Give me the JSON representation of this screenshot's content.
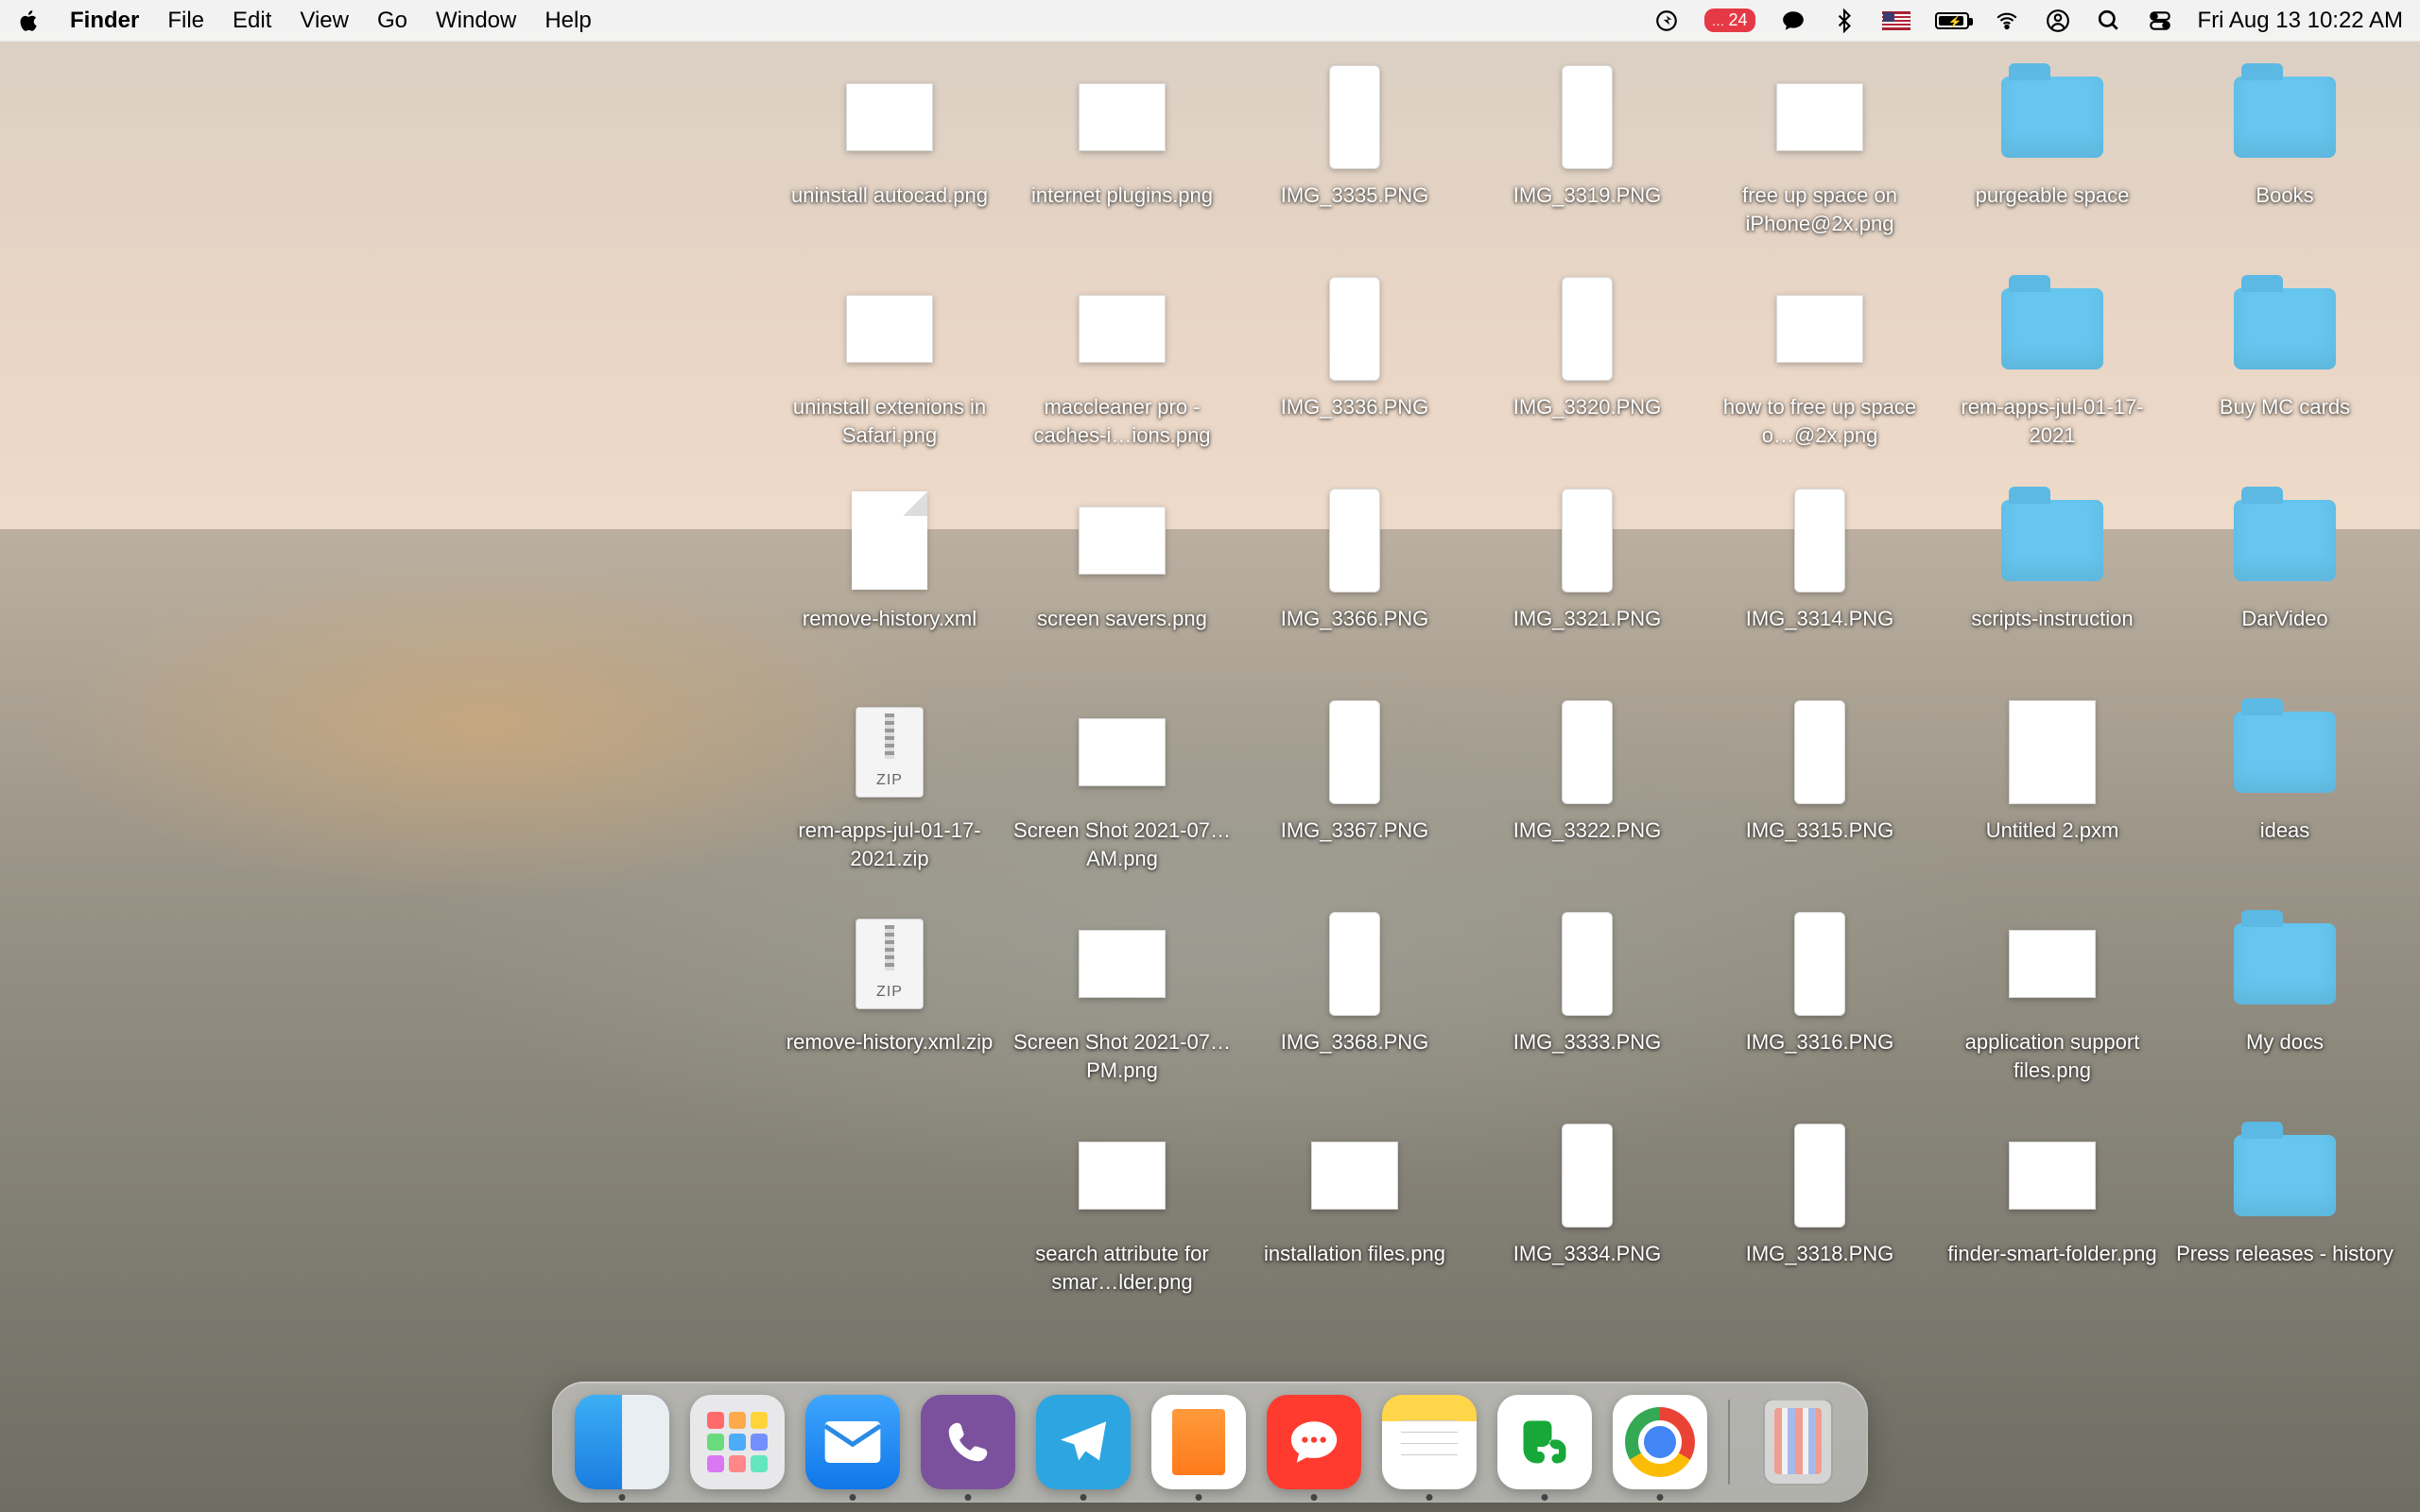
{
  "menubar": {
    "app": "Finder",
    "items": [
      "File",
      "Edit",
      "View",
      "Go",
      "Window",
      "Help"
    ],
    "notification_badge": "24",
    "clock": "Fri Aug 13  10:22 AM"
  },
  "desktop_icons": [
    {
      "row": 0,
      "col": 0,
      "type": "img",
      "label": "uninstall autocad.png"
    },
    {
      "row": 0,
      "col": 1,
      "type": "img",
      "label": "internet plugins.png"
    },
    {
      "row": 0,
      "col": 2,
      "type": "phone",
      "label": "IMG_3335.PNG"
    },
    {
      "row": 0,
      "col": 3,
      "type": "phone",
      "label": "IMG_3319.PNG"
    },
    {
      "row": 0,
      "col": 4,
      "type": "img",
      "label": "free up space on iPhone@2x.png"
    },
    {
      "row": 0,
      "col": 5,
      "type": "folder",
      "label": "purgeable space"
    },
    {
      "row": 0,
      "col": 6,
      "type": "folder",
      "label": "Books"
    },
    {
      "row": 1,
      "col": 0,
      "type": "img",
      "label": "uninstall extenions in Safari.png"
    },
    {
      "row": 1,
      "col": 1,
      "type": "img",
      "label": "maccleaner pro - caches-i…ions.png"
    },
    {
      "row": 1,
      "col": 2,
      "type": "phone",
      "label": "IMG_3336.PNG"
    },
    {
      "row": 1,
      "col": 3,
      "type": "phone",
      "label": "IMG_3320.PNG"
    },
    {
      "row": 1,
      "col": 4,
      "type": "img",
      "label": "how to free up space o…@2x.png"
    },
    {
      "row": 1,
      "col": 5,
      "type": "folder",
      "label": "rem-apps-jul-01-17-2021"
    },
    {
      "row": 1,
      "col": 6,
      "type": "folder",
      "label": "Buy MC cards"
    },
    {
      "row": 2,
      "col": 0,
      "type": "doc",
      "label": "remove-history.xml"
    },
    {
      "row": 2,
      "col": 1,
      "type": "img",
      "label": "screen savers.png"
    },
    {
      "row": 2,
      "col": 2,
      "type": "phone",
      "label": "IMG_3366.PNG"
    },
    {
      "row": 2,
      "col": 3,
      "type": "phone",
      "label": "IMG_3321.PNG"
    },
    {
      "row": 2,
      "col": 4,
      "type": "phone",
      "label": "IMG_3314.PNG"
    },
    {
      "row": 2,
      "col": 5,
      "type": "folder",
      "label": "scripts-instruction"
    },
    {
      "row": 2,
      "col": 6,
      "type": "folder",
      "label": "DarVideo"
    },
    {
      "row": 3,
      "col": 0,
      "type": "zip",
      "label": "rem-apps-jul-01-17-2021.zip"
    },
    {
      "row": 3,
      "col": 1,
      "type": "img",
      "label": "Screen Shot 2021-07…AM.png"
    },
    {
      "row": 3,
      "col": 2,
      "type": "phone",
      "label": "IMG_3367.PNG"
    },
    {
      "row": 3,
      "col": 3,
      "type": "phone",
      "label": "IMG_3322.PNG"
    },
    {
      "row": 3,
      "col": 4,
      "type": "phone",
      "label": "IMG_3315.PNG"
    },
    {
      "row": 3,
      "col": 5,
      "type": "pxm",
      "label": "Untitled 2.pxm"
    },
    {
      "row": 3,
      "col": 6,
      "type": "folder",
      "label": "ideas"
    },
    {
      "row": 4,
      "col": 0,
      "type": "zip",
      "label": "remove-history.xml.zip"
    },
    {
      "row": 4,
      "col": 1,
      "type": "img",
      "label": "Screen Shot 2021-07…PM.png"
    },
    {
      "row": 4,
      "col": 2,
      "type": "phone",
      "label": "IMG_3368.PNG"
    },
    {
      "row": 4,
      "col": 3,
      "type": "phone",
      "label": "IMG_3333.PNG"
    },
    {
      "row": 4,
      "col": 4,
      "type": "phone",
      "label": "IMG_3316.PNG"
    },
    {
      "row": 4,
      "col": 5,
      "type": "img",
      "label": "application support files.png"
    },
    {
      "row": 4,
      "col": 6,
      "type": "folder",
      "label": "My docs"
    },
    {
      "row": 5,
      "col": 1,
      "type": "img",
      "label": "search attribute for smar…lder.png"
    },
    {
      "row": 5,
      "col": 2,
      "type": "img",
      "label": "installation files.png"
    },
    {
      "row": 5,
      "col": 3,
      "type": "phone",
      "label": "IMG_3334.PNG"
    },
    {
      "row": 5,
      "col": 4,
      "type": "phone",
      "label": "IMG_3318.PNG"
    },
    {
      "row": 5,
      "col": 5,
      "type": "img",
      "label": "finder-smart-folder.png"
    },
    {
      "row": 5,
      "col": 6,
      "type": "folder",
      "label": "Press releases - history"
    }
  ],
  "dock": {
    "apps": [
      {
        "name": "Finder",
        "class": "finder",
        "running": true
      },
      {
        "name": "Launchpad",
        "class": "launchpad",
        "running": false
      },
      {
        "name": "Mail",
        "class": "mail",
        "running": true
      },
      {
        "name": "Viber",
        "class": "viber",
        "running": true
      },
      {
        "name": "Telegram",
        "class": "telegram",
        "running": true
      },
      {
        "name": "Pages",
        "class": "pages",
        "running": true
      },
      {
        "name": "iMessage",
        "class": "imsg",
        "running": true
      },
      {
        "name": "Notes",
        "class": "notes",
        "running": true
      },
      {
        "name": "Evernote",
        "class": "evernote",
        "running": true
      },
      {
        "name": "Chrome",
        "class": "chrome",
        "running": true
      }
    ],
    "trash": "Trash"
  },
  "launchpad_colors": [
    "#ff6b6b",
    "#ffa94d",
    "#ffd43b",
    "#69db7c",
    "#4dabf7",
    "#748ffc",
    "#da77f2",
    "#ff8787",
    "#63e6be"
  ]
}
